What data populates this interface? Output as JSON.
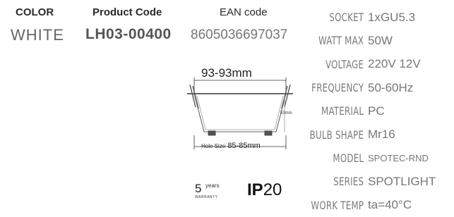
{
  "header": {
    "color_label": "COLOR",
    "code_label": "Product Code",
    "ean_label": "EAN code",
    "color_value": "WHITE",
    "code_value": "LH03-00400",
    "ean_value": "8605036697037"
  },
  "specs": [
    {
      "label": "SOCKET",
      "value": "1xGU5.3"
    },
    {
      "label": "WATT MAX",
      "value": "50W"
    },
    {
      "label": "VOLTAGE",
      "value": "220V 12V"
    },
    {
      "label": "FREQUENCY",
      "value": "50-60Hz"
    },
    {
      "label": "MATERIAL",
      "value": "PC"
    },
    {
      "label": "BULB SHAPE",
      "value": "Mr16"
    },
    {
      "label": "MODEL",
      "value": "SPOTEC-RND"
    },
    {
      "label": "SERIES",
      "value": "SPOTLIGHT"
    },
    {
      "label": "WORK TEMP",
      "value": "ta=40°C"
    }
  ],
  "drawing": {
    "top_dim": "93-93mm",
    "side_dim": "53mm",
    "hole_prefix": "Hole Size",
    "hole_dim": "85-85mm"
  },
  "badges": {
    "warranty_number": "5",
    "warranty_years": "years",
    "warranty_label": "WARRANTY",
    "ip_prefix": "IP",
    "ip_number": "20"
  }
}
